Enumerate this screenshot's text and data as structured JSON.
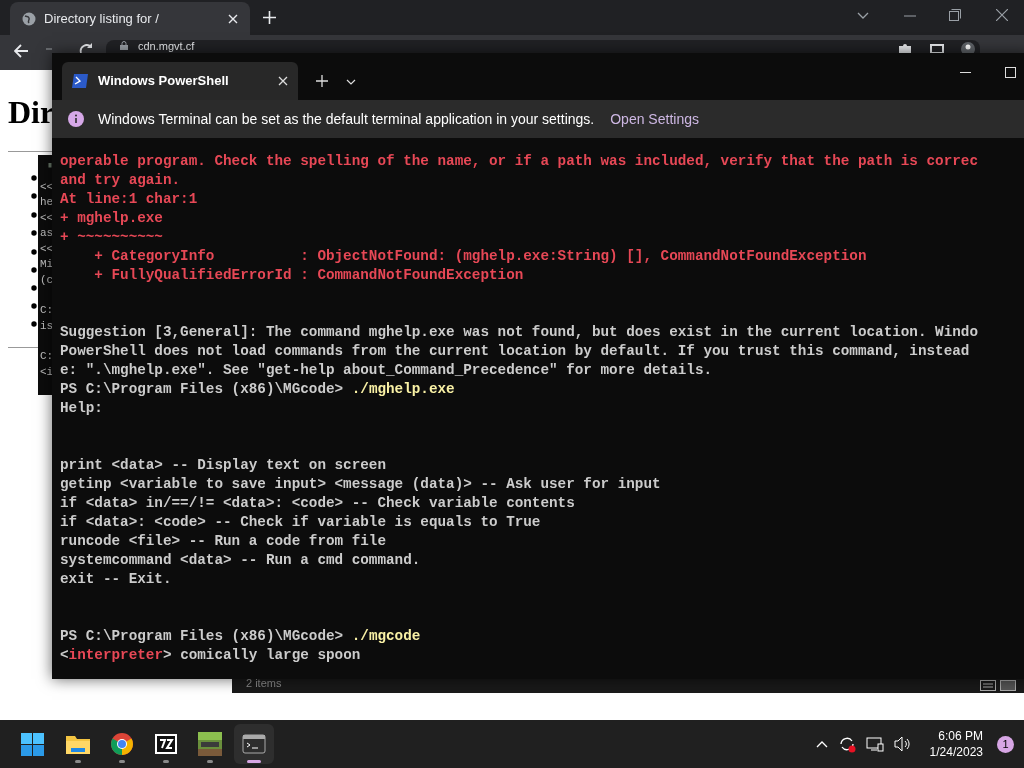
{
  "browser": {
    "tab_title": "Directory listing for /",
    "address": "cdn.mgvt.cf"
  },
  "background_page": {
    "heading": "Dir"
  },
  "background_console": {
    "fragment_groups": [
      {
        "lines": [
          "<<",
          "he",
          "<<",
          "as",
          "<<",
          "Mi",
          "(c"
        ]
      },
      {
        "lines": [
          "C:",
          "is"
        ]
      },
      {
        "lines": [
          "C:",
          "<i"
        ]
      }
    ],
    "status": "2 items"
  },
  "terminal": {
    "tab_title": "Windows PowerShell",
    "notice": {
      "text": "Windows Terminal can be set as the default terminal application in your settings.",
      "link": "Open Settings"
    },
    "lines": [
      {
        "kind": "text",
        "segments": [
          {
            "kind": "error",
            "text": "operable program. Check the spelling of the name, or if a path was included, verify that the path is correc"
          }
        ]
      },
      {
        "kind": "text",
        "segments": [
          {
            "kind": "error",
            "text": "and try again."
          }
        ]
      },
      {
        "kind": "text",
        "segments": [
          {
            "kind": "error",
            "text": "At line:1 char:1"
          }
        ]
      },
      {
        "kind": "text",
        "segments": [
          {
            "kind": "error",
            "text": "+ mghelp.exe"
          }
        ]
      },
      {
        "kind": "text",
        "segments": [
          {
            "kind": "error",
            "text": "+ ~~~~~~~~~~"
          }
        ]
      },
      {
        "kind": "text",
        "segments": [
          {
            "kind": "error",
            "text": "    + CategoryInfo          : ObjectNotFound: (mghelp.exe:String) [], CommandNotFoundException"
          }
        ]
      },
      {
        "kind": "text",
        "segments": [
          {
            "kind": "error",
            "text": "    + FullyQualifiedErrorId : CommandNotFoundException"
          }
        ]
      },
      {
        "kind": "blank"
      },
      {
        "kind": "blank"
      },
      {
        "kind": "text",
        "segments": [
          {
            "kind": "plain",
            "text": "Suggestion [3,General]: The command mghelp.exe was not found, but does exist in the current location. Windo"
          }
        ]
      },
      {
        "kind": "text",
        "segments": [
          {
            "kind": "plain",
            "text": "PowerShell does not load commands from the current location by default. If you trust this command, instead"
          }
        ]
      },
      {
        "kind": "text",
        "segments": [
          {
            "kind": "plain",
            "text": "e: \".\\mghelp.exe\". See \"get-help about_Command_Precedence\" for more details."
          }
        ]
      },
      {
        "kind": "text",
        "segments": [
          {
            "kind": "plain",
            "text": "PS C:\\Program Files (x86)\\MGcode> "
          },
          {
            "kind": "command",
            "text": "./mghelp.exe"
          }
        ]
      },
      {
        "kind": "text",
        "segments": [
          {
            "kind": "plain",
            "text": "Help:"
          }
        ]
      },
      {
        "kind": "blank"
      },
      {
        "kind": "blank"
      },
      {
        "kind": "text",
        "segments": [
          {
            "kind": "plain",
            "text": "print <data> -- Display text on screen"
          }
        ]
      },
      {
        "kind": "text",
        "segments": [
          {
            "kind": "plain",
            "text": "getinp <variable to save input> <message (data)> -- Ask user for input"
          }
        ]
      },
      {
        "kind": "text",
        "segments": [
          {
            "kind": "plain",
            "text": "if <data> in/==/!= <data>: <code> -- Check variable contents"
          }
        ]
      },
      {
        "kind": "text",
        "segments": [
          {
            "kind": "plain",
            "text": "if <data>: <code> -- Check if variable is equals to True"
          }
        ]
      },
      {
        "kind": "text",
        "segments": [
          {
            "kind": "plain",
            "text": "runcode <file> -- Run a code from file"
          }
        ]
      },
      {
        "kind": "text",
        "segments": [
          {
            "kind": "plain",
            "text": "systemcommand <data> -- Run a cmd command."
          }
        ]
      },
      {
        "kind": "text",
        "segments": [
          {
            "kind": "plain",
            "text": "exit -- Exit."
          }
        ]
      },
      {
        "kind": "blank"
      },
      {
        "kind": "blank"
      },
      {
        "kind": "text",
        "segments": [
          {
            "kind": "plain",
            "text": "PS C:\\Program Files (x86)\\MGcode> "
          },
          {
            "kind": "command",
            "text": "./mgcode"
          }
        ]
      },
      {
        "kind": "text",
        "segments": [
          {
            "kind": "plain",
            "text": "<"
          },
          {
            "kind": "error",
            "text": "interpreter"
          },
          {
            "kind": "plain",
            "text": "> comically large spoon"
          }
        ]
      }
    ]
  },
  "taskbar": {
    "apps": [
      {
        "kind": "explorer",
        "selected": false
      },
      {
        "kind": "chrome",
        "selected": false
      },
      {
        "kind": "archiver",
        "selected": false
      },
      {
        "kind": "game",
        "selected": false
      },
      {
        "kind": "terminal",
        "selected": true
      }
    ],
    "clock": {
      "time": "6:06 PM",
      "date": "1/24/2023"
    },
    "notification_count": "1"
  }
}
